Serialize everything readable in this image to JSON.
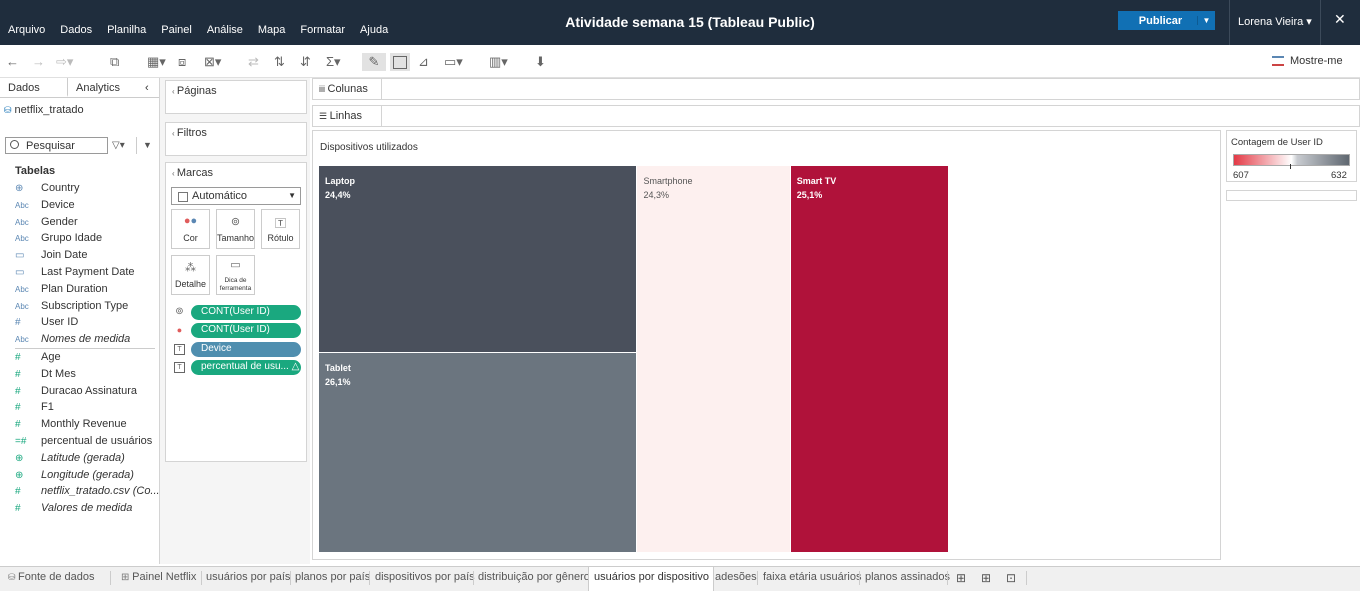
{
  "topbar": {
    "menu": [
      "Arquivo",
      "Dados",
      "Planilha",
      "Painel",
      "Análise",
      "Mapa",
      "Formatar",
      "Ajuda"
    ],
    "title": "Atividade semana 15 (Tableau Public)",
    "publish_label": "Publicar",
    "user_label": "Lorena Vieira ▾",
    "close": "✕"
  },
  "toolbar": {
    "show_me": "Mostre-me"
  },
  "left_panel": {
    "tab_data": "Dados",
    "tab_analytics": "Analytics",
    "datasource": "netflix_tratado",
    "search_placeholder": "Pesquisar",
    "tables_heading": "Tabelas",
    "dimensions": [
      {
        "icon": "⊕",
        "type": "geo",
        "label": "Country"
      },
      {
        "icon": "Abc",
        "type": "str",
        "label": "Device"
      },
      {
        "icon": "Abc",
        "type": "str",
        "label": "Gender"
      },
      {
        "icon": "Abc",
        "type": "str",
        "label": "Grupo Idade"
      },
      {
        "icon": "▭",
        "type": "date",
        "label": "Join Date"
      },
      {
        "icon": "▭",
        "type": "date",
        "label": "Last Payment Date"
      },
      {
        "icon": "Abc",
        "type": "str",
        "label": "Plan Duration"
      },
      {
        "icon": "Abc",
        "type": "str",
        "label": "Subscription Type"
      },
      {
        "icon": "#",
        "type": "num",
        "label": "User ID"
      },
      {
        "icon": "Abc",
        "type": "str",
        "label": "Nomes de medida",
        "italic": true
      }
    ],
    "measures": [
      {
        "icon": "#",
        "label": "Age"
      },
      {
        "icon": "#",
        "label": "Dt Mes"
      },
      {
        "icon": "#",
        "label": "Duracao Assinatura"
      },
      {
        "icon": "#",
        "label": "F1"
      },
      {
        "icon": "#",
        "label": "Monthly Revenue"
      },
      {
        "icon": "=#",
        "label": "percentual de usuários"
      },
      {
        "icon": "⊕",
        "label": "Latitude (gerada)",
        "italic": true
      },
      {
        "icon": "⊕",
        "label": "Longitude (gerada)",
        "italic": true
      },
      {
        "icon": "#",
        "label": "netflix_tratado.csv (Co...",
        "italic": true
      },
      {
        "icon": "#",
        "label": "Valores de medida",
        "italic": true
      }
    ]
  },
  "cards": {
    "pages": "Páginas",
    "filters": "Filtros",
    "marks": "Marcas",
    "mark_type": "Automático",
    "mark_buttons": [
      "Cor",
      "Tamanho",
      "Rótulo",
      "Detalhe",
      "Dica de ferramenta"
    ],
    "pills": [
      {
        "label": "CONT(User ID)",
        "kind": "size"
      },
      {
        "label": "CONT(User ID)",
        "kind": "color"
      },
      {
        "label": "Device",
        "kind": "label"
      },
      {
        "label": "percentual de usu... △",
        "kind": "label"
      }
    ]
  },
  "shelves": {
    "columns": "Colunas",
    "rows": "Linhas"
  },
  "sheet": {
    "title": "Dispositivos utilizados"
  },
  "chart_data": {
    "type": "treemap",
    "title": "Dispositivos utilizados",
    "items": [
      {
        "label": "Laptop",
        "pct": "24,4%",
        "value": 24.4,
        "color": "#4a505c",
        "text": "#ffffff"
      },
      {
        "label": "Tablet",
        "pct": "26,1%",
        "value": 26.1,
        "color": "#6b757f",
        "text": "#ffffff"
      },
      {
        "label": "Smartphone",
        "pct": "24,3%",
        "value": 24.3,
        "color": "#fdf0ef",
        "text": "#555555"
      },
      {
        "label": "Smart TV",
        "pct": "25,1%",
        "value": 25.1,
        "color": "#b0123a",
        "text": "#ffffff"
      }
    ],
    "legend_title": "Contagem de User ID",
    "legend_min": "607",
    "legend_max": "632"
  },
  "sheet_tabs": {
    "datasource": "Fonte de dados",
    "tabs": [
      "Painel Netflix",
      "usuários por país",
      "planos por país",
      "dispositivos por país",
      "distribuição por gênero",
      "usuários por dispositivo",
      "adesões",
      "faixa etária usuários",
      "planos assinados"
    ],
    "active": "usuários por dispositivo"
  }
}
